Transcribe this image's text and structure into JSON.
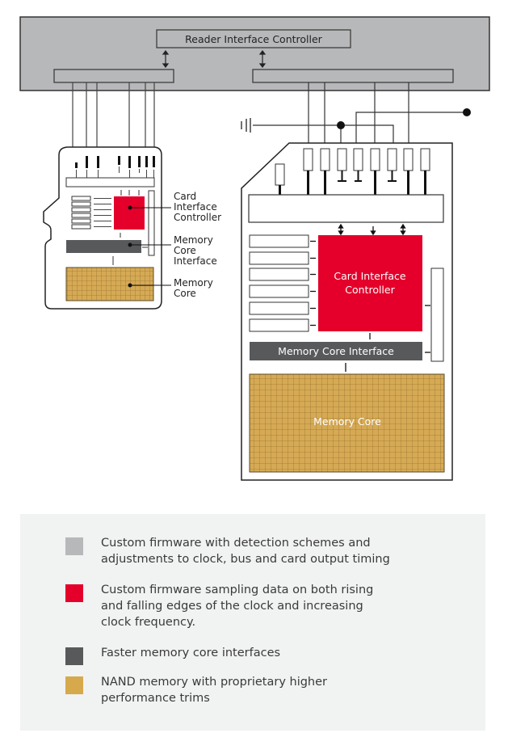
{
  "diagram": {
    "reader_title": "Reader Interface Controller",
    "micro_labels": {
      "controller": [
        "Card",
        "Interface",
        "Controller"
      ],
      "interface": [
        "Memory",
        "Core",
        "Interface"
      ],
      "core": [
        "Memory",
        "Core"
      ]
    },
    "sd_labels": {
      "controller": [
        "Card Interface",
        "Controller"
      ],
      "interface": "Memory Core Interface",
      "core": "Memory Core"
    },
    "colors": {
      "reader_gray": "#b7b8ba",
      "controller_red": "#e4002b",
      "interface_dark": "#58595b",
      "core_gold": "#d4a84a"
    }
  },
  "legend": {
    "items": [
      {
        "color": "#b7b8ba",
        "text": "Custom firmware with detection schemes and adjustments to clock, bus and card output timing"
      },
      {
        "color": "#e4002b",
        "text": "Custom firmware sampling data on both rising and falling edges of the clock and increasing clock frequency."
      },
      {
        "color": "#58595b",
        "text": "Faster memory core interfaces"
      },
      {
        "color": "#d6a94d",
        "text": "NAND memory with proprietary higher performance trims"
      }
    ]
  }
}
